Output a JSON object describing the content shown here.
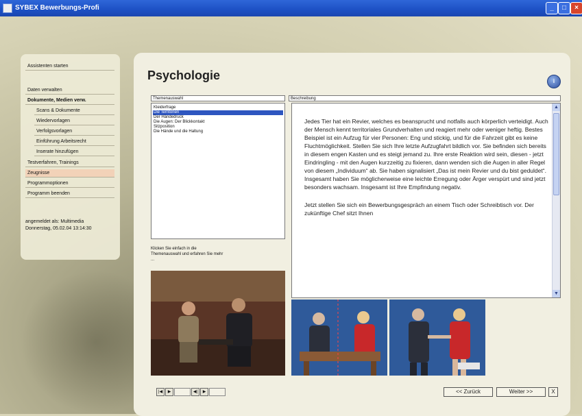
{
  "window": {
    "title": "SYBEX Bewerbungs-Profi",
    "minimize": "_",
    "maximize": "□",
    "close": "×"
  },
  "sidebar": {
    "items": [
      {
        "label": "Assistenten starten"
      },
      {
        "label": "Daten verwalten"
      },
      {
        "label": "Dokumente, Medien verw."
      },
      {
        "label": "Scans & Dokumente"
      },
      {
        "label": "Wiedervorlagen"
      },
      {
        "label": "Verfolgsvorlagen"
      },
      {
        "label": "Einführung Arbeitsrecht"
      },
      {
        "label": "Inserate hinzufügen"
      },
      {
        "label": "Testverfahren, Trainings"
      },
      {
        "label": "Zeugnisse"
      },
      {
        "label": "Programmoptionen"
      },
      {
        "label": "Programm beenden"
      }
    ],
    "login_line1": "angemeldet als: Multimedia",
    "login_line2": "Donnerstag, 05.02.04   13:14:30"
  },
  "main": {
    "title": "Psychologie",
    "info_label": "i",
    "topics_header": "Themenauswahl",
    "description_header": "Beschreibung",
    "topics": [
      "Kleiderfrage",
      "Die Territorien",
      "Der Händedruck",
      "Die Augen: Der Blickkontakt",
      "Sitzposition",
      "Die Hände und die Haltung"
    ],
    "selected_topic": 1,
    "hint": "Klicken Sie einfach in die Themenauswahl und erfahren Sie mehr ...",
    "description": [
      "Jedes Tier hat ein Revier, welches es beansprucht und notfalls auch körperlich verteidigt. Auch der Mensch kennt territoriales Grundverhalten und reagiert mehr oder weniger heftig. Bestes Beispiel ist ein Aufzug für vier Personen: Eng und stickig, und für die Fahrzeit gibt es keine Fluchtmöglichkeit. Stellen Sie sich Ihre letzte Aufzugfahrt bildlich vor. Sie befinden sich bereits in diesem engen Kasten und es steigt jemand zu. Ihre erste Reaktion wird sein, diesen - jetzt Eindringling - mit den Augen kurzzeitig zu fixieren, dann wenden sich die Augen in aller Regel von diesem „Individuum“ ab. Sie haben signalisiert „Das ist mein Revier und du bist geduldet“. Insgesamt haben Sie möglicherweise eine leichte Erregung oder Ärger verspürt und sind jetzt besonders wachsam. Insgesamt ist Ihre Empfindung negativ.",
      "Jetzt stellen Sie sich ein Bewerbungsgespräch an einem Tisch oder Schreibtisch vor. Der zukünftige Chef sitzt Ihnen"
    ],
    "scroll_up": "▲",
    "scroll_down": "▼"
  },
  "media": {
    "first": "|◀",
    "play": "▶",
    "prev": "◀|",
    "next": "▶"
  },
  "footer": {
    "back_label": "<< Zurück",
    "next_label": "Weiter >>",
    "close_label": "X"
  },
  "colors": {
    "titlebar": "#1d50c4",
    "selection": "#2e56c0",
    "active_nav": "#f2d2b8",
    "panel_bg": "#f1efe1"
  }
}
